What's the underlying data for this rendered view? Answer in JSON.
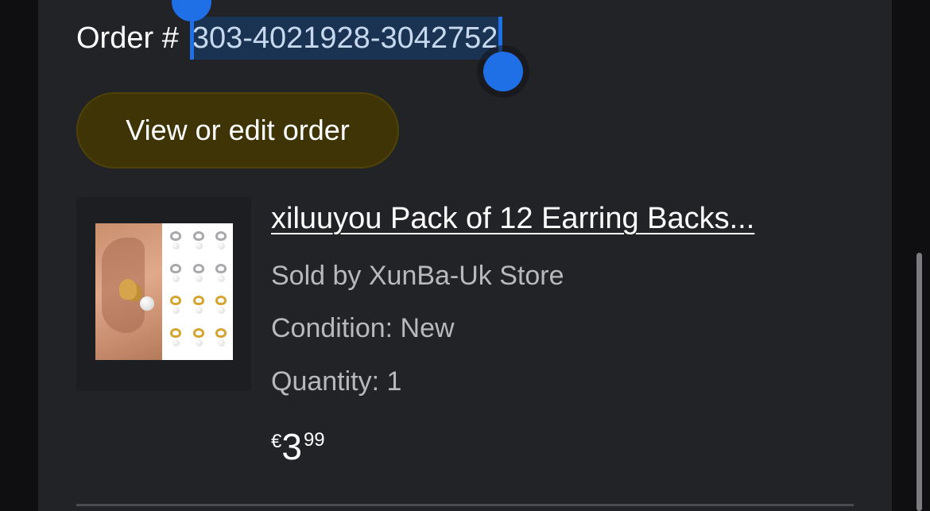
{
  "order": {
    "label": "Order #",
    "number": "303-4021928-3042752"
  },
  "actions": {
    "view_edit_label": "View or edit order"
  },
  "item": {
    "thumbnail_icon": "earring-backs-product-image",
    "title": "xiluuyou Pack of 12 Earring Backs...",
    "seller": "Sold by XunBa-Uk Store",
    "condition": "Condition: New",
    "quantity": "Quantity: 1",
    "price": {
      "currency": "€",
      "whole": "3",
      "fraction": "99"
    }
  },
  "colors": {
    "panel_bg": "#222327",
    "selection_bg": "#1a3352",
    "selection_handle": "#1f6fe6",
    "button_bg": "#3f3406"
  }
}
